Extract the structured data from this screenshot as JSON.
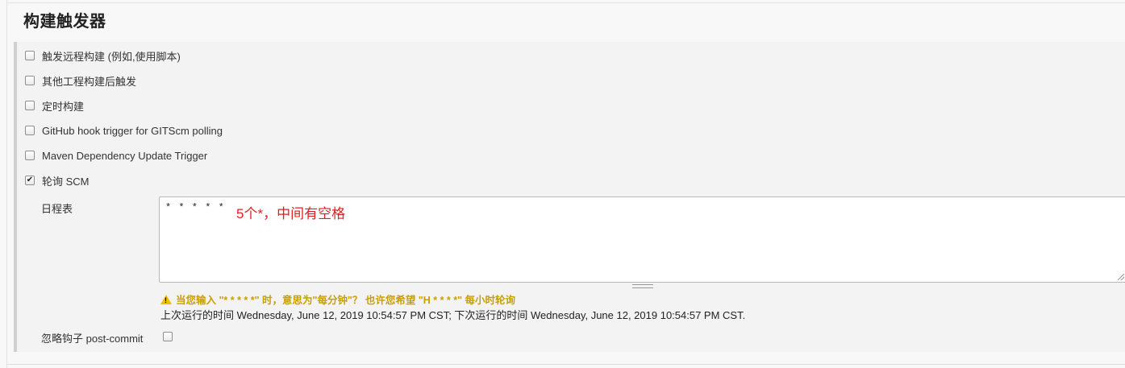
{
  "section": {
    "title": "构建触发器"
  },
  "options": [
    {
      "label": "触发远程构建 (例如,使用脚本)",
      "checked": false
    },
    {
      "label": "其他工程构建后触发",
      "checked": false
    },
    {
      "label": "定时构建",
      "checked": false
    },
    {
      "label": "GitHub hook trigger for GITScm polling",
      "checked": false
    },
    {
      "label": "Maven Dependency Update Trigger",
      "checked": false
    },
    {
      "label": "轮询 SCM",
      "checked": true
    }
  ],
  "schedule": {
    "label": "日程表",
    "value": "* * * * *",
    "annotation": "5个*，中间有空格"
  },
  "warning": {
    "text": "当您输入 \"* * * * *\" 时，意思为\"每分钟\"？ 也许您希望 \"H * * * *\" 每小时轮询"
  },
  "run_info": {
    "text": "上次运行的时间 Wednesday, June 12, 2019 10:54:57 PM CST; 下次运行的时间 Wednesday, June 12, 2019 10:54:57 PM CST."
  },
  "ignore_post_commit": {
    "label": "忽略钩子 post-commit",
    "checked": false
  },
  "colors": {
    "annotation": "#e02020",
    "warning": "#c8a000",
    "warning_icon": "#f0c000"
  },
  "icons": {
    "warning": "warning-icon",
    "checkmark": "check-icon"
  }
}
